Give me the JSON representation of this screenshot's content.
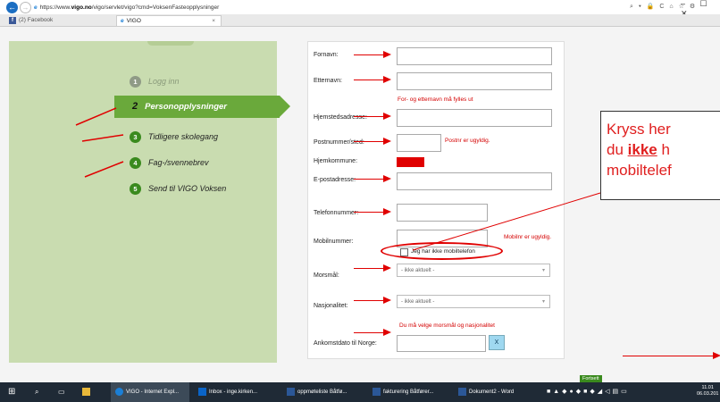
{
  "browser": {
    "url_prefix": "https://www.",
    "url_domain": "vigo.no",
    "url_path": "/vigo/servlet/vigo?cmd=VoksenFasteopplysninger",
    "address_icons": "⌕ ▾ 🔒 C",
    "toolbar_icons": "⌂ ☆ ⚙",
    "window_controls": "– ☐ ✕",
    "tabs": [
      {
        "label": "(2) Facebook",
        "icon_text": "f"
      },
      {
        "label": "VIGO",
        "icon_text": "e",
        "close": "×"
      }
    ]
  },
  "steps": [
    {
      "num": "1",
      "label": "Logg inn",
      "state": "done"
    },
    {
      "num": "2",
      "label": "Personopplysninger",
      "state": "active"
    },
    {
      "num": "3",
      "label": "Tidligere skolegang",
      "state": "todo"
    },
    {
      "num": "4",
      "label": "Fag-/svennebrev",
      "state": "todo"
    },
    {
      "num": "5",
      "label": "Send til VIGO Voksen",
      "state": "todo"
    }
  ],
  "form": {
    "fornavn_label": "Fornavn:",
    "etternavn_label": "Etternavn:",
    "name_error": "For- og etternavn må fylles ut",
    "hjemstedsadresse_label": "Hjemstedsadresse:",
    "postnummer_label": "Postnummer/sted:",
    "postnummer_error": "Postnr er ugyldig.",
    "hjemkommune_label": "Hjemkommune:",
    "epost_label": "E-postadresse:",
    "telefon_label": "Telefonnummer:",
    "mobil_label": "Mobilnummer:",
    "mobil_error": "Mobilnr er ugyldig.",
    "no_mobile_checkbox_label": "Jeg har ikke mobiltelefon",
    "morsmal_label": "Morsmål:",
    "morsmal_value": "- ikke aktuelt -",
    "nasjonalitet_label": "Nasjonalitet:",
    "nasjonalitet_value": "- ikke aktuelt -",
    "language_error": "Du må velge morsmål og nasjonalitet",
    "ankomstdato_label": "Ankomstdato til Norge:",
    "clear_button": "X",
    "bottom_button_partial": "Fortsett"
  },
  "callout": {
    "line1": "Kryss her",
    "line2_prefix": "du ",
    "line2_underlined": "ikke",
    "line2_suffix": " h",
    "line3": "mobiltelef"
  },
  "taskbar": {
    "items": [
      {
        "label": "VIGO - Internet Expl...",
        "color": "#1b7fd6"
      },
      {
        "label": "Inbox - inge.kirken...",
        "color": "#0a64c8"
      },
      {
        "label": "oppmøteliste Båtfø...",
        "color": "#2b5797"
      },
      {
        "label": "fakturering Båtfører...",
        "color": "#2b5797"
      },
      {
        "label": "Dokument2 - Word",
        "color": "#2b5797"
      }
    ],
    "time": "11.01",
    "date": "06.03.201"
  },
  "colors": {
    "accent_green": "#6aa93b",
    "sidebar_bg": "#c9dcb0",
    "error_red": "#d40000",
    "annotation_red": "#e00000"
  }
}
